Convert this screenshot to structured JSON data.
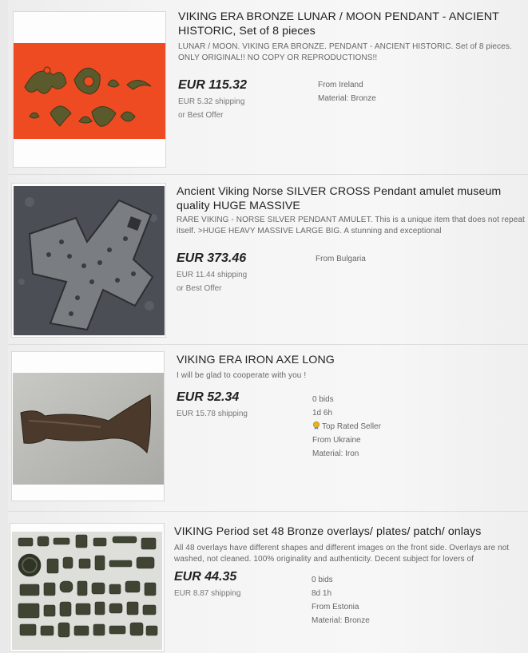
{
  "listings": [
    {
      "title": "VIKING ERA BRONZE LUNAR / MOON PENDANT - ANCIENT HISTORIC, Set of 8 pieces",
      "description": "LUNAR / MOON. VIKING ERA BRONZE. PENDANT - ANCIENT HISTORIC. Set of 8 pieces. ONLY ORIGINAL!! NO COPY OR REPRODUCTIONS!!",
      "price": "EUR 115.32",
      "shipping": "EUR 5.32 shipping",
      "best_offer": "or Best Offer",
      "details": [
        "From Ireland",
        "Material: Bronze"
      ],
      "image_icon": "bronze-moon-pendants-photo"
    },
    {
      "title": "Ancient Viking Norse SILVER CROSS Pendant amulet museum quality HUGE MASSIVE",
      "description": "RARE VIKING - NORSE SILVER PENDANT AMULET. This is a unique item that does not repeat itself. >HUGE HEAVY MASSIVE LARGE BIG. A stunning and exceptional",
      "price": "EUR 373.46",
      "shipping": "EUR 11.44 shipping",
      "best_offer": "or Best Offer",
      "details": [
        "From Bulgaria"
      ],
      "image_icon": "silver-cross-pendant-photo"
    },
    {
      "title": "VIKING ERA IRON AXE LONG",
      "description": "I will be glad to cooperate with you !",
      "price": "EUR 52.34",
      "shipping": "EUR 15.78 shipping",
      "details": [
        "0 bids",
        "1d 6h",
        "Top Rated Seller",
        "From Ukraine",
        "Material: Iron"
      ],
      "image_icon": "iron-axe-photo"
    },
    {
      "title": "VIKING Period set 48 Bronze overlays/ plates/ patch/ onlays",
      "description": "All 48 overlays have different shapes and different images on the front side. Overlays are not washed, not cleaned. 100% originality and authenticity. Decent subject for lovers of",
      "price": "EUR 44.35",
      "shipping": "EUR 8.87 shipping",
      "details": [
        "0 bids",
        "8d 1h",
        "From Estonia",
        "Material: Bronze"
      ],
      "image_icon": "bronze-overlays-set-photo"
    }
  ],
  "colors": {
    "price": "#222222",
    "trs_badge": "#e6b422"
  }
}
